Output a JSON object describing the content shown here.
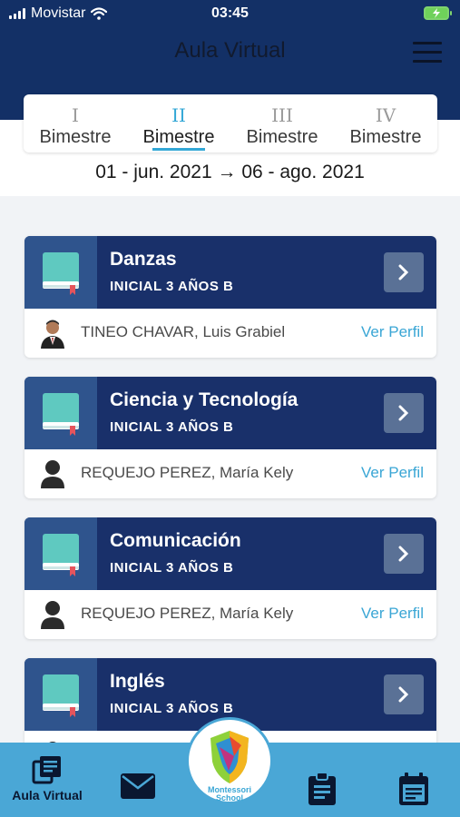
{
  "status_bar": {
    "carrier": "Movistar",
    "time": "03:45"
  },
  "header": {
    "title": "Aula Virtual"
  },
  "tabs": [
    {
      "roman": "I",
      "label": "Bimestre",
      "active": false
    },
    {
      "roman": "II",
      "label": "Bimestre",
      "active": true
    },
    {
      "roman": "III",
      "label": "Bimestre",
      "active": false
    },
    {
      "roman": "IV",
      "label": "Bimestre",
      "active": false
    }
  ],
  "date_range": "01 - jun. 2021 → 06 - ago. 2021",
  "courses": [
    {
      "subject": "Danzas",
      "grade": "INICIAL 3 AÑOS B",
      "teacher": "TINEO CHAVAR, Luis Grabiel",
      "profile_link": "Ver Perfil",
      "avatar": "photo"
    },
    {
      "subject": "Ciencia y Tecnología",
      "grade": "INICIAL 3 AÑOS B",
      "teacher": "REQUEJO PEREZ, María Kely",
      "profile_link": "Ver Perfil",
      "avatar": "placeholder"
    },
    {
      "subject": "Comunicación",
      "grade": "INICIAL 3 AÑOS B",
      "teacher": "REQUEJO PEREZ, María Kely",
      "profile_link": "Ver Perfil",
      "avatar": "placeholder"
    },
    {
      "subject": "Inglés",
      "grade": "INICIAL 3 AÑOS B",
      "teacher": "",
      "profile_link": "",
      "avatar": "placeholder"
    }
  ],
  "bottom_nav": {
    "aula_virtual_label": "Aula Virtual",
    "logo_text_line1": "Montessori",
    "logo_text_line2": "School",
    "icons": [
      "book-list-icon",
      "mail-icon",
      "clipboard-icon",
      "calendar-icon"
    ]
  },
  "colors": {
    "header_bg": "#133066",
    "card_head": "#19306a",
    "accent": "#33a7d6",
    "nav_bg": "#4aa7d6"
  }
}
